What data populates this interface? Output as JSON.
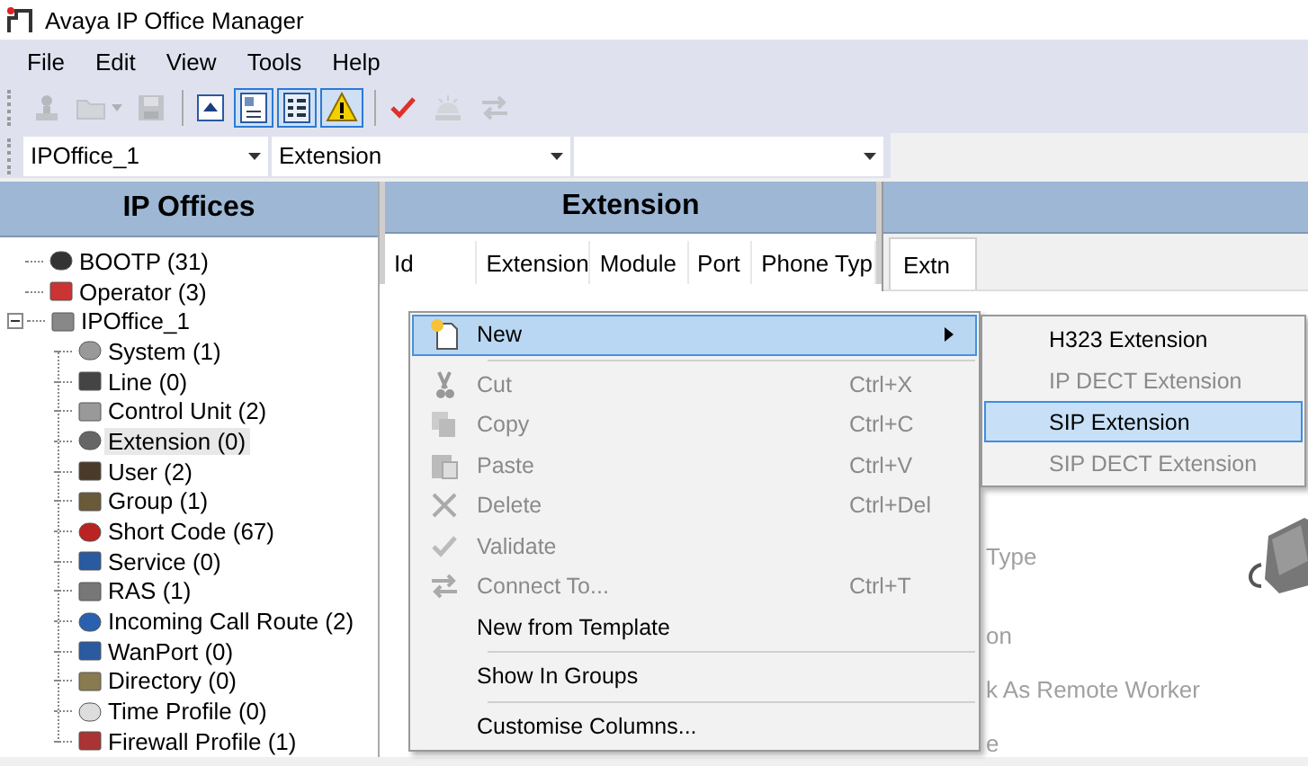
{
  "window": {
    "title": "Avaya IP Office Manager"
  },
  "menu_bar": [
    "File",
    "Edit",
    "View",
    "Tools",
    "Help"
  ],
  "toolbar": [
    {
      "kind": "button",
      "disabled": true,
      "pressed": false
    },
    {
      "kind": "dropdown",
      "disabled": true,
      "pressed": false
    },
    {
      "kind": "button",
      "disabled": true,
      "pressed": false
    },
    {
      "kind": "separator"
    },
    {
      "kind": "button",
      "disabled": false,
      "pressed": false
    },
    {
      "kind": "button",
      "disabled": false,
      "pressed": true
    },
    {
      "kind": "button",
      "disabled": false,
      "pressed": true
    },
    {
      "kind": "button",
      "disabled": false,
      "pressed": true
    },
    {
      "kind": "separator"
    },
    {
      "kind": "button",
      "disabled": false,
      "pressed": false
    },
    {
      "kind": "button",
      "disabled": true,
      "pressed": false
    },
    {
      "kind": "button",
      "disabled": true,
      "pressed": false
    }
  ],
  "selectors": [
    {
      "value": "IPOffice_1"
    },
    {
      "value": "Extension"
    }
  ],
  "left_panel": {
    "title": "IP Offices",
    "tree": [
      {
        "label": "BOOTP (31)",
        "selected": false
      },
      {
        "label": "Operator (3)",
        "selected": false
      },
      {
        "label": "IPOffice_1",
        "selected": false,
        "expanded": true,
        "children": [
          {
            "label": "System (1)",
            "selected": false
          },
          {
            "label": "Line (0)",
            "selected": false
          },
          {
            "label": "Control Unit (2)",
            "selected": false
          },
          {
            "label": "Extension (0)",
            "selected": true
          },
          {
            "label": "User (2)",
            "selected": false
          },
          {
            "label": "Group (1)",
            "selected": false
          },
          {
            "label": "Short Code (67)",
            "selected": false
          },
          {
            "label": "Service (0)",
            "selected": false
          },
          {
            "label": "RAS (1)",
            "selected": false
          },
          {
            "label": "Incoming Call Route (2)",
            "selected": false
          },
          {
            "label": "WanPort (0)",
            "selected": false
          },
          {
            "label": "Directory (0)",
            "selected": false
          },
          {
            "label": "Time Profile (0)",
            "selected": false
          },
          {
            "label": "Firewall Profile (1)",
            "selected": false
          }
        ]
      }
    ]
  },
  "extension_panel": {
    "title": "Extension",
    "columns": [
      "Id",
      "Extension",
      "Module",
      "Port",
      "Phone Typ"
    ]
  },
  "detail_panel": {
    "tabs": [
      {
        "label": "Extn",
        "selected": true
      }
    ],
    "labels": [
      "Type",
      "on",
      "k As Remote Worker",
      "e"
    ]
  },
  "context_menu": {
    "items": [
      {
        "kind": "item",
        "label": "New",
        "submenu": true,
        "selected": true,
        "disabled": false
      },
      {
        "kind": "separator"
      },
      {
        "kind": "item",
        "label": "Cut",
        "shortcut": "Ctrl+X",
        "selected": false,
        "disabled": true
      },
      {
        "kind": "item",
        "label": "Copy",
        "shortcut": "Ctrl+C",
        "selected": false,
        "disabled": true
      },
      {
        "kind": "item",
        "label": "Paste",
        "shortcut": "Ctrl+V",
        "selected": false,
        "disabled": true
      },
      {
        "kind": "item",
        "label": "Delete",
        "shortcut": "Ctrl+Del",
        "selected": false,
        "disabled": true
      },
      {
        "kind": "item",
        "label": "Validate",
        "selected": false,
        "disabled": true
      },
      {
        "kind": "item",
        "label": "Connect To...",
        "shortcut": "Ctrl+T",
        "selected": false,
        "disabled": true
      },
      {
        "kind": "item",
        "label": "New from Template",
        "selected": false,
        "disabled": false
      },
      {
        "kind": "separator"
      },
      {
        "kind": "item",
        "label": "Show In Groups",
        "selected": false,
        "disabled": false
      },
      {
        "kind": "separator"
      },
      {
        "kind": "item",
        "label": "Customise Columns...",
        "selected": false,
        "disabled": false
      }
    ]
  },
  "submenu": {
    "items": [
      {
        "label": "H323 Extension",
        "selected": false,
        "disabled": false
      },
      {
        "label": "IP DECT Extension",
        "selected": false,
        "disabled": true
      },
      {
        "label": "SIP Extension",
        "selected": true,
        "disabled": false
      },
      {
        "label": "SIP DECT Extension",
        "selected": false,
        "disabled": true
      }
    ]
  }
}
